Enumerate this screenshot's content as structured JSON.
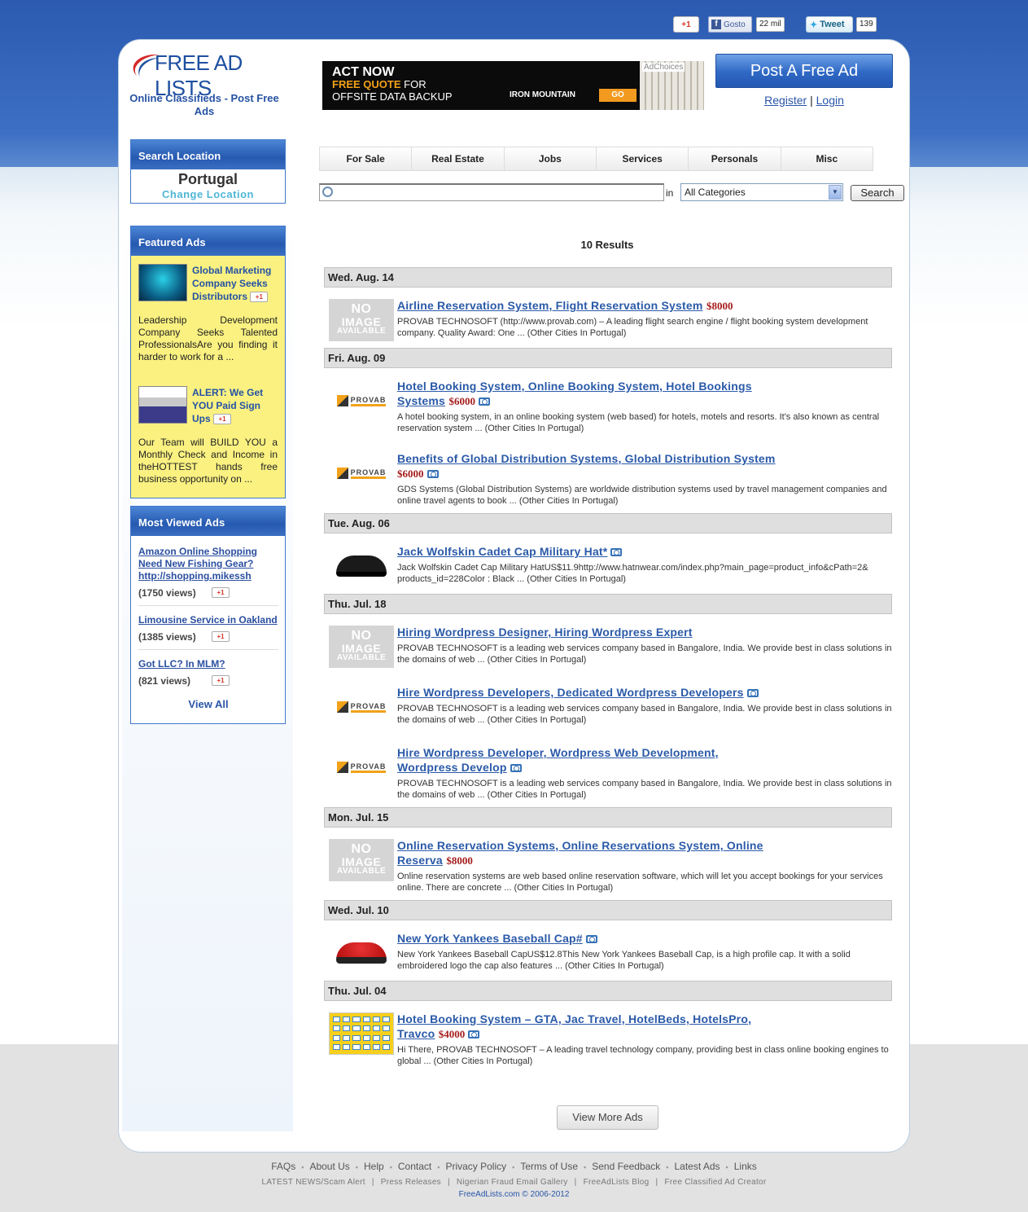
{
  "social": {
    "gplus": "+1",
    "fb_label": "Gosto",
    "fb_count": "22 mil",
    "tweet_label": "Tweet",
    "tweet_count": "139"
  },
  "header": {
    "logo_text": "FREE AD LISTS",
    "tagline": "Online Classifieds - Post Free Ads",
    "post_button": "Post A Free Ad",
    "register": "Register",
    "separator": "|",
    "login": "Login"
  },
  "ad_banner": {
    "line1": "ACT NOW",
    "line2": "FREE QUOTE",
    "line2b": "FOR",
    "line3": "OFFSITE DATA BACKUP",
    "brand": "IRON MOUNTAIN",
    "go": "GO",
    "adchoices": "AdChoices"
  },
  "location": {
    "heading": "Search Location",
    "name": "Portugal",
    "change": "Change Location"
  },
  "featured": {
    "heading": "Featured Ads",
    "items": [
      {
        "title": "Global Marketing Company Seeks Distributors",
        "desc": "Leadership Development Company Seeks Talented ProfessionalsAre you finding it harder to work for a ..."
      },
      {
        "title": "ALERT: We Get YOU Paid Sign Ups",
        "desc": "Our Team will BUILD YOU a Monthly Check and Income in theHOTTEST hands free business opportunity on ..."
      }
    ],
    "gplus": "+1"
  },
  "most_viewed": {
    "heading": "Most Viewed Ads",
    "items": [
      {
        "title": "Amazon Online Shopping Need New Fishing Gear? http://shopping.mikessh",
        "views": "(1750 views)"
      },
      {
        "title": "Limousine Service in Oakland",
        "views": "(1385 views)"
      },
      {
        "title": "Got LLC? In MLM?",
        "views": "(821 views)"
      }
    ],
    "view_all": "View All"
  },
  "nav": [
    "For Sale",
    "Real Estate",
    "Jobs",
    "Services",
    "Personals",
    "Misc"
  ],
  "search": {
    "in_label": "in",
    "category": "All Categories",
    "button": "Search",
    "query": ""
  },
  "results_count": "10 Results",
  "groups": [
    {
      "date": "Wed. Aug. 14",
      "items": [
        {
          "thumb": "noimage",
          "title": "Airline Reservation System, Flight Reservation System",
          "price": "$8000",
          "photo": false,
          "desc": "PROVAB TECHNOSOFT (http://www.provab.com) – A leading flight search engine / flight booking system development company.  Quality Award: One ... (Other Cities In Portugal)"
        }
      ]
    },
    {
      "date": "Fri. Aug. 09",
      "items": [
        {
          "thumb": "provab",
          "title": "Hotel Booking System, Online Booking System, Hotel Bookings Systems",
          "price": "$6000",
          "photo": true,
          "desc": "A hotel booking system, in an online booking system (web based) for hotels, motels and resorts. It's also known as central reservation system ... (Other Cities In Portugal)"
        },
        {
          "thumb": "provab",
          "title": "Benefits of Global Distribution Systems, Global Distribution System",
          "price": "$6000",
          "photo": true,
          "desc": "GDS Systems (Global Distribution Systems) are worldwide distribution systems used by travel management companies and online travel agents to book ... (Other Cities In Portugal)"
        }
      ]
    },
    {
      "date": "Tue. Aug. 06",
      "items": [
        {
          "thumb": "cap-black",
          "title": "Jack Wolfskin Cadet Cap Military Hat*",
          "price": "",
          "photo": true,
          "desc": "Jack Wolfskin Cadet Cap Military HatUS$11.9http://www.hatnwear.com/index.php?main_page=product_info&cPath=2& products_id=228Color : Black ... (Other Cities In Portugal)"
        }
      ]
    },
    {
      "date": "Thu. Jul. 18",
      "items": [
        {
          "thumb": "noimage",
          "title": "Hiring Wordpress Designer, Hiring Wordpress Expert",
          "price": "",
          "photo": false,
          "desc": "PROVAB TECHNOSOFT is a leading web services company based in Bangalore, India. We provide best in class solutions in the domains of web ... (Other Cities In Portugal)"
        },
        {
          "thumb": "provab",
          "title": "Hire Wordpress Developers, Dedicated Wordpress Developers",
          "price": "",
          "photo": true,
          "desc": "PROVAB TECHNOSOFT is a leading web services company based in Bangalore, India. We provide best in class solutions in the domains of web ... (Other Cities In Portugal)"
        },
        {
          "thumb": "provab",
          "title": "Hire Wordpress Developer, Wordpress Web Development, Wordpress Develop",
          "price": "",
          "photo": true,
          "desc": "PROVAB TECHNOSOFT is a leading web services company based in Bangalore, India. We provide best in class solutions in the domains of web ... (Other Cities In Portugal)"
        }
      ]
    },
    {
      "date": "Mon. Jul. 15",
      "items": [
        {
          "thumb": "noimage",
          "title": "Online Reservation Systems, Online Reservations System, Online Reserva",
          "price": "$8000",
          "photo": false,
          "desc": "Online reservation systems are web based online reservation software, which will let you accept bookings for your services online. There are concrete ... (Other Cities In Portugal)"
        }
      ]
    },
    {
      "date": "Wed. Jul. 10",
      "items": [
        {
          "thumb": "cap-red",
          "title": "New York Yankees Baseball Cap#",
          "price": "",
          "photo": true,
          "desc": "New York Yankees Baseball CapUS$12.8This New York Yankees Baseball Cap, is a high profile cap. It with a solid embroidered logo the cap also features ... (Other Cities In Portugal)"
        }
      ]
    },
    {
      "date": "Thu. Jul. 04",
      "items": [
        {
          "thumb": "gta",
          "title": "Hotel Booking System – GTA, Jac Travel, HotelBeds, HotelsPro, Travco",
          "price": "$4000",
          "photo": true,
          "desc": "Hi There, PROVAB TECHNOSOFT – A leading travel technology company, providing best in class online booking engines to global ... (Other Cities In Portugal)"
        }
      ]
    }
  ],
  "no_image": {
    "l1": "NO",
    "l2": "IMAGE",
    "l3": "AVAILABLE"
  },
  "provab_logo": "PROVAB",
  "view_more": "View More Ads",
  "footer": {
    "links": [
      "FAQs",
      "About Us",
      "Help",
      "Contact",
      "Privacy Policy",
      "Terms of Use",
      "Send Feedback",
      "Latest Ads",
      "Links"
    ],
    "links2": [
      "LATEST NEWS/Scam Alert",
      "Press Releases",
      "Nigerian Fraud Email Gallery",
      "FreeAdLists Blog",
      "Free Classified Ad Creator"
    ],
    "copyright": "FreeAdLists.com © 2006-2012"
  },
  "colors": {
    "brand_blue": "#2b5ab0",
    "featured_bg": "#faf181",
    "price_red": "#a61d1d",
    "date_bar": "#dfdfdf"
  }
}
